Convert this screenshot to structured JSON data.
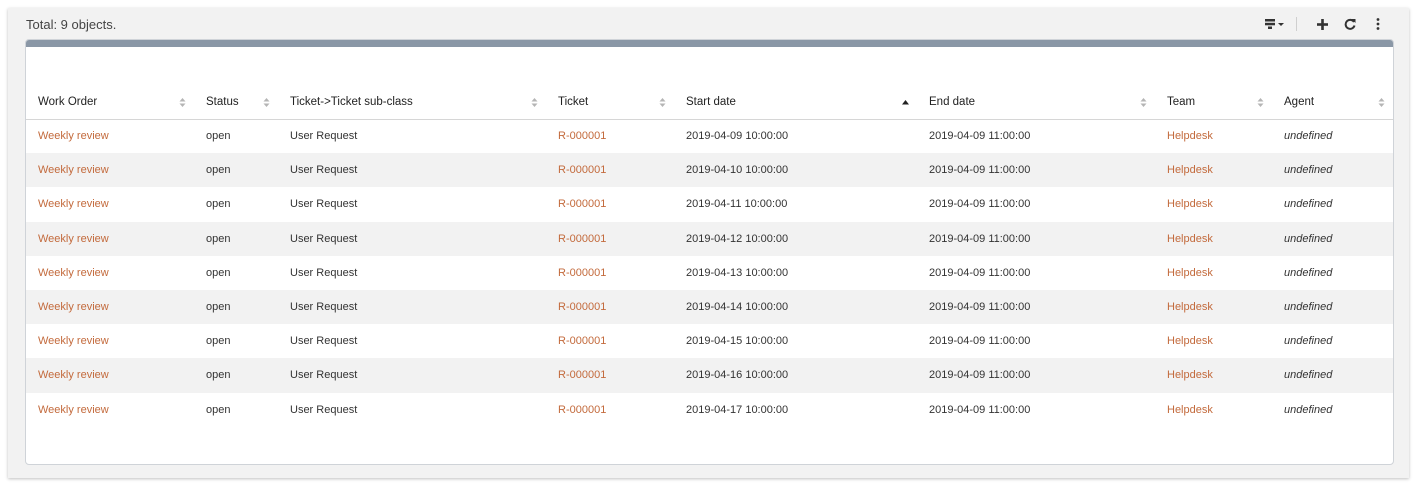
{
  "header": {
    "total": "Total: 9 objects."
  },
  "toolbar": {
    "icons": [
      "list-filter-icon",
      "plus-icon",
      "refresh-icon",
      "more-vertical-icon"
    ]
  },
  "table": {
    "columns": [
      "Work Order",
      "Status",
      "Ticket->Ticket sub-class",
      "Ticket",
      "Start date",
      "End date",
      "Team",
      "Agent"
    ],
    "sorted_column": "Start date",
    "rows": [
      {
        "work_order": "Weekly review",
        "status": "open",
        "subclass": "User Request",
        "ticket": "R-000001",
        "start": "2019-04-09 10:00:00",
        "end": "2019-04-09 11:00:00",
        "team": "Helpdesk",
        "agent": "undefined"
      },
      {
        "work_order": "Weekly review",
        "status": "open",
        "subclass": "User Request",
        "ticket": "R-000001",
        "start": "2019-04-10 10:00:00",
        "end": "2019-04-09 11:00:00",
        "team": "Helpdesk",
        "agent": "undefined"
      },
      {
        "work_order": "Weekly review",
        "status": "open",
        "subclass": "User Request",
        "ticket": "R-000001",
        "start": "2019-04-11 10:00:00",
        "end": "2019-04-09 11:00:00",
        "team": "Helpdesk",
        "agent": "undefined"
      },
      {
        "work_order": "Weekly review",
        "status": "open",
        "subclass": "User Request",
        "ticket": "R-000001",
        "start": "2019-04-12 10:00:00",
        "end": "2019-04-09 11:00:00",
        "team": "Helpdesk",
        "agent": "undefined"
      },
      {
        "work_order": "Weekly review",
        "status": "open",
        "subclass": "User Request",
        "ticket": "R-000001",
        "start": "2019-04-13 10:00:00",
        "end": "2019-04-09 11:00:00",
        "team": "Helpdesk",
        "agent": "undefined"
      },
      {
        "work_order": "Weekly review",
        "status": "open",
        "subclass": "User Request",
        "ticket": "R-000001",
        "start": "2019-04-14 10:00:00",
        "end": "2019-04-09 11:00:00",
        "team": "Helpdesk",
        "agent": "undefined"
      },
      {
        "work_order": "Weekly review",
        "status": "open",
        "subclass": "User Request",
        "ticket": "R-000001",
        "start": "2019-04-15 10:00:00",
        "end": "2019-04-09 11:00:00",
        "team": "Helpdesk",
        "agent": "undefined"
      },
      {
        "work_order": "Weekly review",
        "status": "open",
        "subclass": "User Request",
        "ticket": "R-000001",
        "start": "2019-04-16 10:00:00",
        "end": "2019-04-09 11:00:00",
        "team": "Helpdesk",
        "agent": "undefined"
      },
      {
        "work_order": "Weekly review",
        "status": "open",
        "subclass": "User Request",
        "ticket": "R-000001",
        "start": "2019-04-17 10:00:00",
        "end": "2019-04-09 11:00:00",
        "team": "Helpdesk",
        "agent": "undefined"
      }
    ]
  },
  "colors": {
    "link": "#c36a3c",
    "panel_bar": "#8a97a6",
    "row_stripe": "#f2f2f2"
  }
}
